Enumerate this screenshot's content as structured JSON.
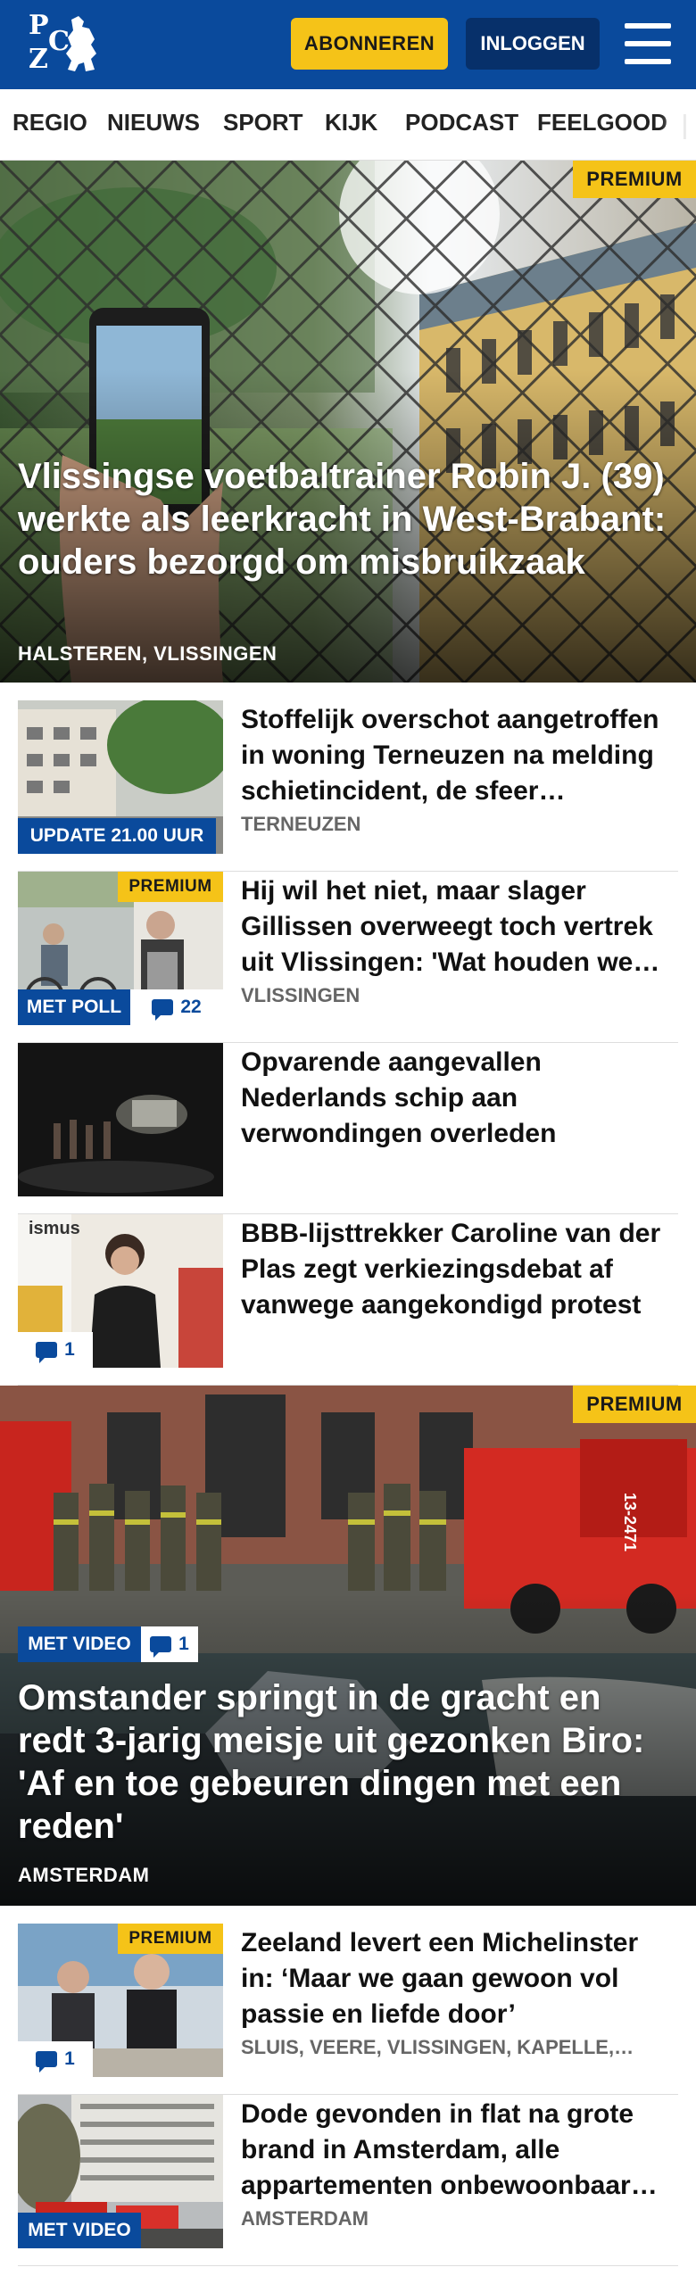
{
  "header": {
    "logo_letters": [
      "P",
      "Z",
      "C"
    ],
    "subscribe_label": "ABONNEREN",
    "login_label": "INLOGGEN",
    "brand_color": "#0a4a9c",
    "accent_color": "#f5c318"
  },
  "nav": {
    "items": [
      "REGIO",
      "NIEUWS",
      "SPORT",
      "KIJK",
      "PODCAST",
      "FEELGOOD"
    ]
  },
  "hero1": {
    "badge": "PREMIUM",
    "title": "Vlissingse voetbaltrainer Robin J. (39) werkte als leerkracht in West-Brabant: ouders bezorgd om misbruikzaak",
    "location": "HALSTEREN, VLISSINGEN"
  },
  "articles": [
    {
      "title": "Stoffelijk overschot aangetroffen in woning Terneuzen na melding schietincident, de sfeer…",
      "location": "TERNEUZEN",
      "badge_blue": "UPDATE 21.00 UUR"
    },
    {
      "title": "Hij wil het niet, maar slager Gillissen overweegt toch vertrek uit Vlissingen: 'Wat houden we…",
      "location": "VLISSINGEN",
      "badge_premium": "PREMIUM",
      "badge_blue": "MET POLL",
      "comments": "22"
    },
    {
      "title": "Opvarende aangevallen Nederlands schip aan verwondingen overleden"
    },
    {
      "title": "BBB-lijsttrekker Caroline van der Plas zegt verkiezingsdebat af vanwege aangekondigd protest",
      "comments": "1",
      "sign_text": "ismus"
    }
  ],
  "hero2": {
    "badge": "PREMIUM",
    "video_label": "MET VIDEO",
    "comments": "1",
    "title": "Omstander springt in de gracht en redt 3-jarig meisje uit gezonken Biro: 'Af en toe gebeuren dingen met een reden'",
    "location": "AMSTERDAM",
    "truck_label": "13-2471"
  },
  "articles2": [
    {
      "title": "Zeeland levert een Michelinster in: ‘Maar we gaan gewoon vol passie en liefde door’",
      "location": "SLUIS, VEERE, VLISSINGEN, KAPELLE,…",
      "badge_premium": "PREMIUM",
      "comments": "1"
    },
    {
      "title": "Dode gevonden in flat na grote brand in Amsterdam, alle appartementen onbewoonbaar…",
      "location": "AMSTERDAM",
      "badge_blue": "MET VIDEO"
    }
  ]
}
